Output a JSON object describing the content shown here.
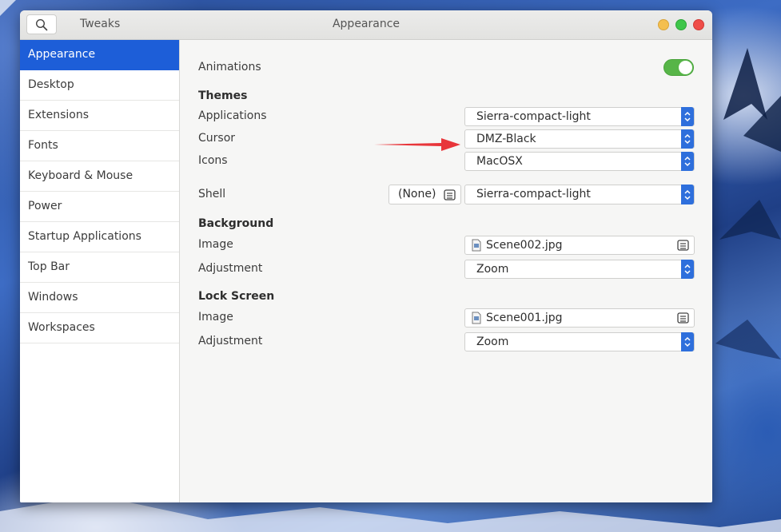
{
  "header": {
    "app_title": "Tweaks",
    "window_title": "Appearance",
    "search_icon": "search-icon"
  },
  "sidebar": {
    "items": [
      {
        "label": "Appearance",
        "active": true
      },
      {
        "label": "Desktop"
      },
      {
        "label": "Extensions"
      },
      {
        "label": "Fonts"
      },
      {
        "label": "Keyboard & Mouse"
      },
      {
        "label": "Power"
      },
      {
        "label": "Startup Applications"
      },
      {
        "label": "Top Bar"
      },
      {
        "label": "Windows"
      },
      {
        "label": "Workspaces"
      }
    ]
  },
  "animations": {
    "label": "Animations",
    "enabled": true
  },
  "themes": {
    "heading": "Themes",
    "applications": {
      "label": "Applications",
      "value": "Sierra-compact-light"
    },
    "cursor": {
      "label": "Cursor",
      "value": "DMZ-Black"
    },
    "icons": {
      "label": "Icons",
      "value": "MacOSX"
    },
    "shell": {
      "label": "Shell",
      "extension_button": "(None)",
      "value": "Sierra-compact-light"
    }
  },
  "background": {
    "heading": "Background",
    "image": {
      "label": "Image",
      "value": "Scene002.jpg"
    },
    "adjustment": {
      "label": "Adjustment",
      "value": "Zoom"
    }
  },
  "lock_screen": {
    "heading": "Lock Screen",
    "image": {
      "label": "Image",
      "value": "Scene001.jpg"
    },
    "adjustment": {
      "label": "Adjustment",
      "value": "Zoom"
    }
  },
  "colors": {
    "accent": "#1d5ed8",
    "toggle_on": "#57b548",
    "annotation_arrow": "#e8353a"
  }
}
